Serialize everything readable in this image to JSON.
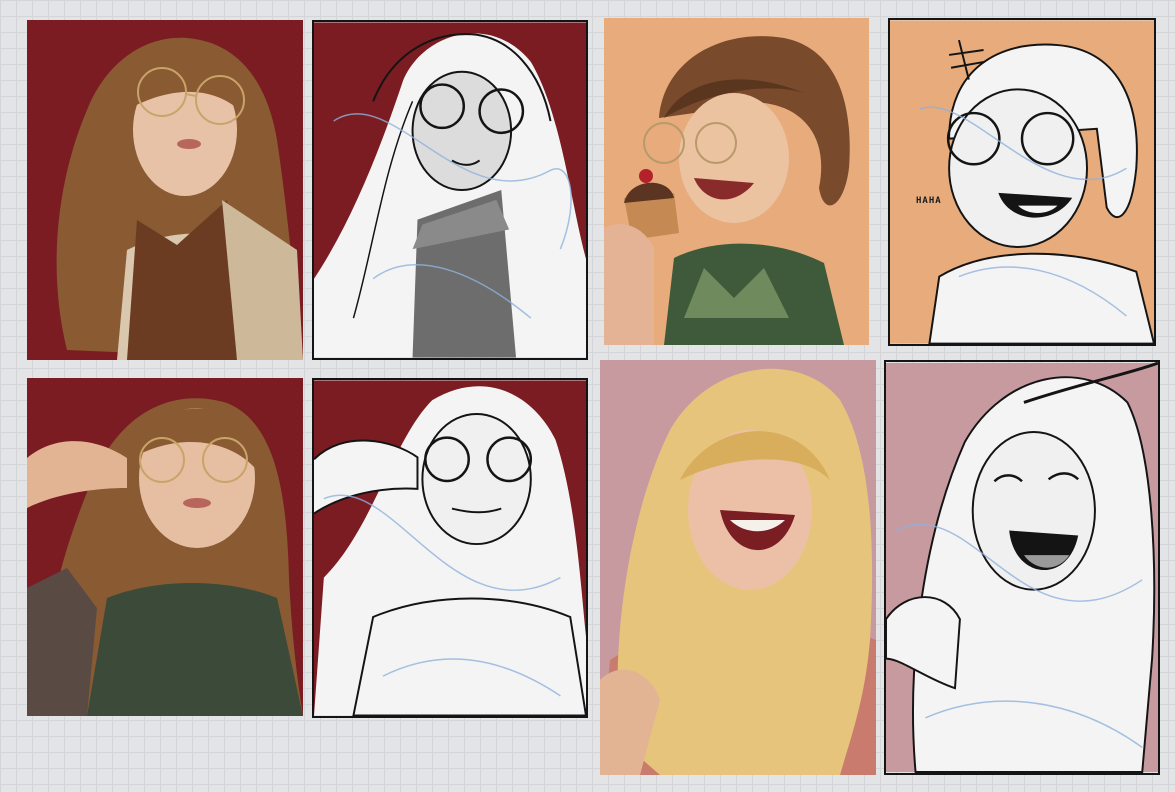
{
  "canvas": {
    "background": "#e3e4e6",
    "grid_color": "#d3d5d8"
  },
  "colors": {
    "burgundy": "#7a1c22",
    "peach": "#e7ab7c",
    "rose": "#c79aa0",
    "ink": "#141414",
    "construction_blue": "#8fb2dc",
    "brown_hair": "#8a5a32",
    "blonde_hair": "#e7c47b"
  },
  "panels": [
    {
      "kind": "photo",
      "subject": "girl-glasses-scarf-trenchcoat",
      "background": "burgundy"
    },
    {
      "kind": "sketch",
      "subject": "girl-glasses-turtleneck-coat",
      "background": "burgundy"
    },
    {
      "kind": "photo",
      "subject": "girl-laughing-eating-cupcake",
      "background": "peach"
    },
    {
      "kind": "sketch",
      "subject": "girl-laughing-cupcake",
      "background": "peach",
      "annotation": "HAHA"
    },
    {
      "kind": "photo",
      "subject": "girl-adjusting-glasses",
      "background": "burgundy"
    },
    {
      "kind": "sketch",
      "subject": "girl-adjusting-glasses",
      "background": "burgundy"
    },
    {
      "kind": "photo",
      "subject": "blonde-girl-laughing-wind",
      "background": "rose"
    },
    {
      "kind": "sketch",
      "subject": "blonde-girl-laughing-wind",
      "background": "rose"
    }
  ]
}
